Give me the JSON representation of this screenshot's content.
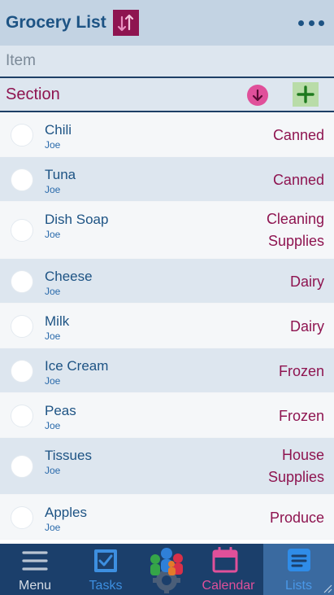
{
  "header": {
    "title": "Grocery List",
    "sort_icon": "sort-arrows-icon",
    "more_icon": "more-dots-icon"
  },
  "item_input": {
    "placeholder": "Item",
    "value": ""
  },
  "section_bar": {
    "label": "Section",
    "down_icon": "arrow-down-circle-icon",
    "add_icon": "plus-icon"
  },
  "items": [
    {
      "name": "Chili",
      "user": "Joe",
      "section": "Canned"
    },
    {
      "name": "Tuna",
      "user": "Joe",
      "section": "Canned"
    },
    {
      "name": "Dish Soap",
      "user": "Joe",
      "section": "Cleaning\nSupplies"
    },
    {
      "name": "Cheese",
      "user": "Joe",
      "section": "Dairy"
    },
    {
      "name": "Milk",
      "user": "Joe",
      "section": "Dairy"
    },
    {
      "name": "Ice Cream",
      "user": "Joe",
      "section": "Frozen"
    },
    {
      "name": "Peas",
      "user": "Joe",
      "section": "Frozen"
    },
    {
      "name": "Tissues",
      "user": "Joe",
      "section": "House\nSupplies"
    },
    {
      "name": "Apples",
      "user": "Joe",
      "section": "Produce"
    }
  ],
  "tabbar": {
    "menu": "Menu",
    "tasks": "Tasks",
    "calendar": "Calendar",
    "lists": "Lists"
  },
  "colors": {
    "brand_blue": "#1d5384",
    "accent_magenta": "#8e1450",
    "tabbar_bg": "#1b3f6b"
  }
}
